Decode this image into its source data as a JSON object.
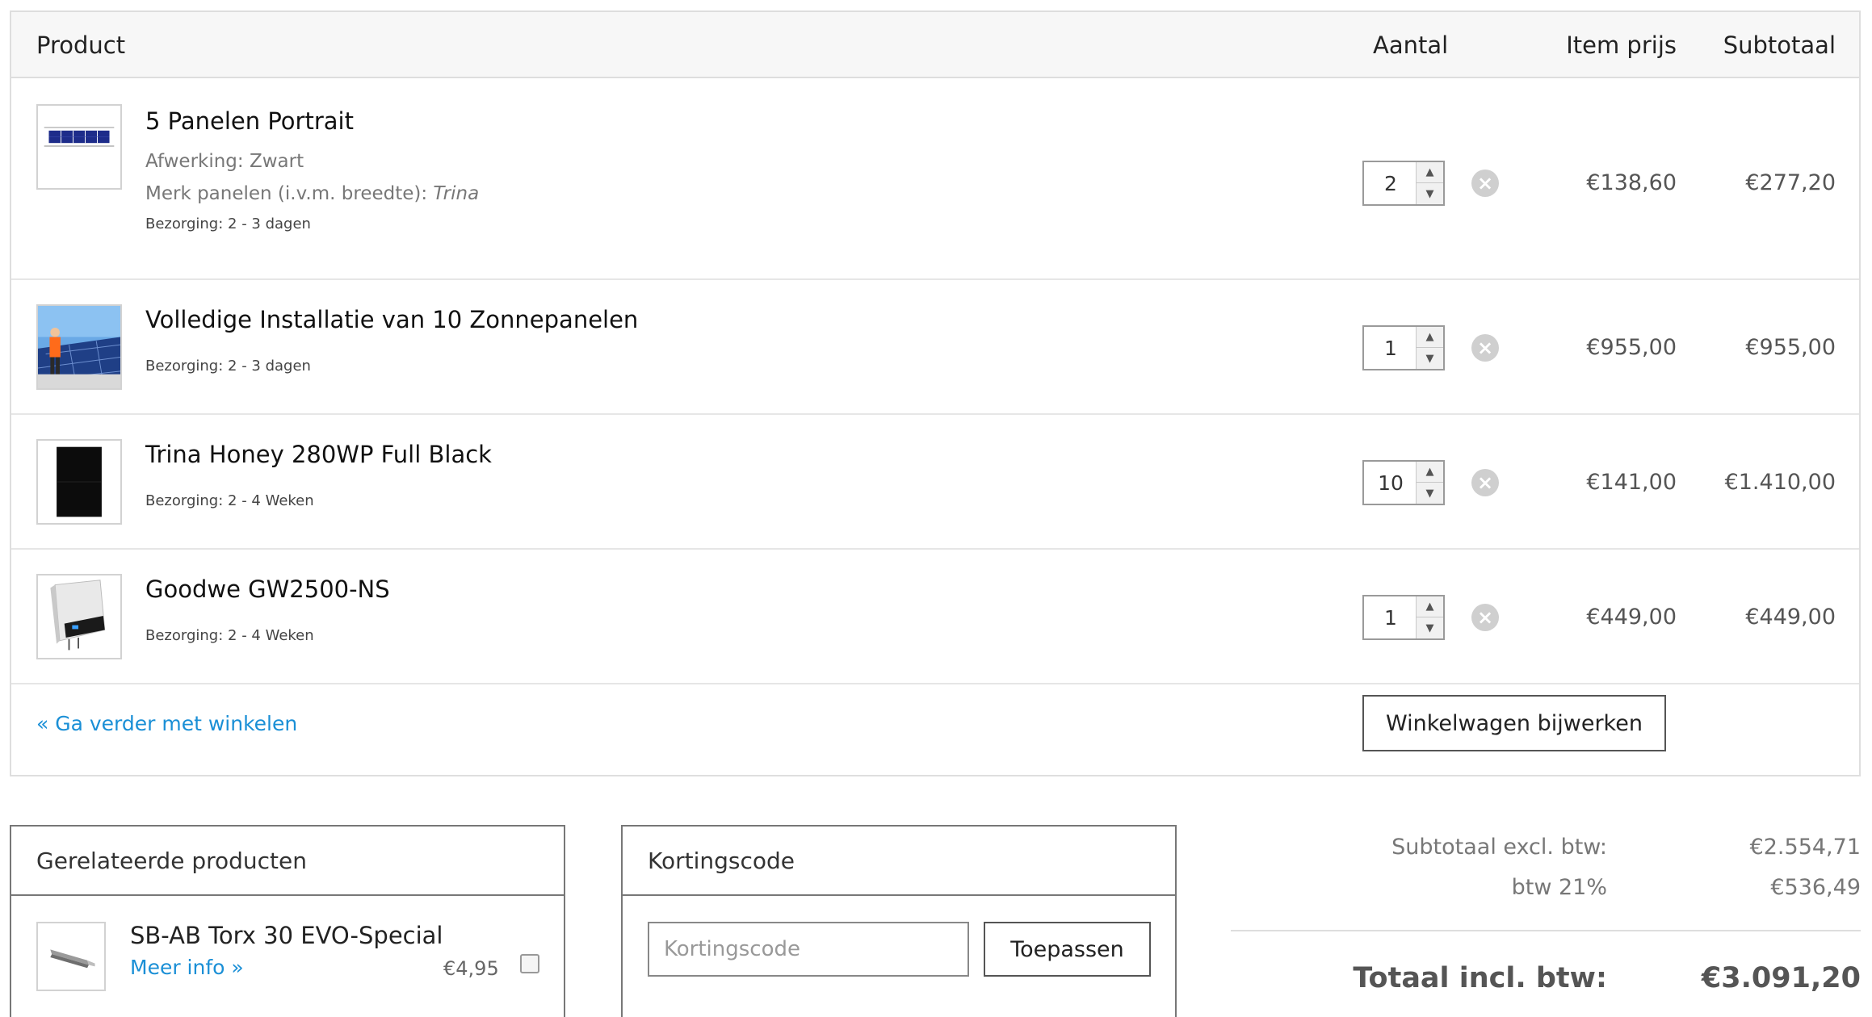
{
  "header": {
    "product": "Product",
    "quantity": "Aantal",
    "item_price": "Item prijs",
    "subtotal": "Subtotaal"
  },
  "items": [
    {
      "title": "5 Panelen Portrait",
      "attr1_label": "Afwerking: Zwart",
      "attr2_label": "Merk panelen (i.v.m. breedte): ",
      "attr2_value": "Trina",
      "delivery": "Bezorging: 2 - 3 dagen",
      "quantity": "2",
      "price": "€138,60",
      "subtotal": "€277,20",
      "thumb_icon": "solar-panel-array-icon"
    },
    {
      "title": "Volledige Installatie van 10 Zonnepanelen",
      "delivery": "Bezorging: 2 - 3 dagen",
      "quantity": "1",
      "price": "€955,00",
      "subtotal": "€955,00",
      "thumb_icon": "installation-photo-icon"
    },
    {
      "title": "Trina Honey 280WP Full Black",
      "delivery": "Bezorging: 2 - 4 Weken",
      "quantity": "10",
      "price": "€141,00",
      "subtotal": "€1.410,00",
      "thumb_icon": "black-solar-panel-icon"
    },
    {
      "title": "Goodwe GW2500-NS",
      "delivery": "Bezorging: 2 - 4 Weken",
      "quantity": "1",
      "price": "€449,00",
      "subtotal": "€449,00",
      "thumb_icon": "inverter-icon"
    }
  ],
  "actions": {
    "continue_shopping": "« Ga verder met winkelen",
    "update_cart": "Winkelwagen bijwerken"
  },
  "related": {
    "title": "Gerelateerde producten",
    "product_title": "SB-AB Torx 30 EVO-Special",
    "more_info": "Meer info »",
    "price": "€4,95",
    "thumb_icon": "torx-bit-icon"
  },
  "coupon": {
    "title": "Kortingscode",
    "placeholder": "Kortingscode",
    "apply": "Toepassen"
  },
  "totals": {
    "subtotal_label": "Subtotaal excl. btw:",
    "subtotal_value": "€2.554,71",
    "vat_label": "btw 21%",
    "vat_value": "€536,49",
    "total_label": "Totaal incl. btw:",
    "total_value": "€3.091,20"
  },
  "colors": {
    "link": "#1a8fd6",
    "border": "#dedede",
    "header_bg": "#f7f7f7",
    "remove_icon": "#cfcfcf"
  }
}
